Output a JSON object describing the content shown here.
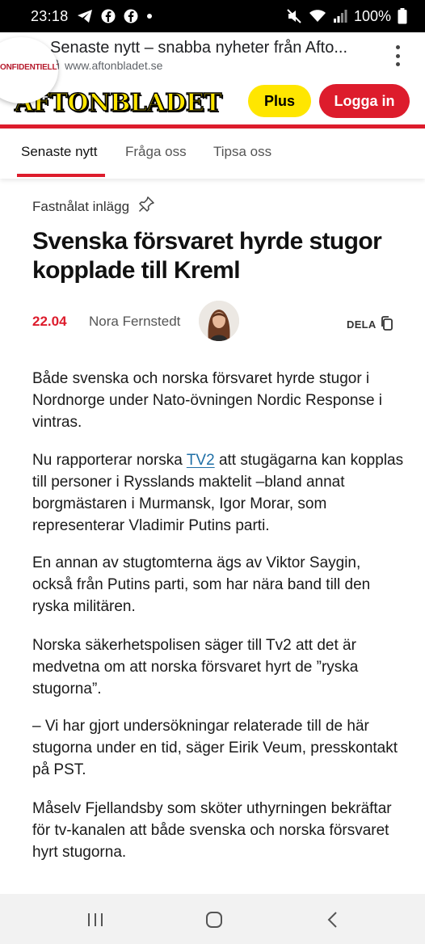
{
  "status_bar": {
    "time": "23:18",
    "battery": "100%",
    "icons": [
      "telegram-icon",
      "facebook-icon",
      "facebook-icon",
      "dot-icon",
      "mute-icon",
      "wifi-icon",
      "signal-icon",
      "battery-icon"
    ]
  },
  "browser": {
    "title": "Senaste nytt – snabba nyheter från Afto...",
    "url": "www.aftonbladet.se"
  },
  "site": {
    "logo_text": "AFTONBLADET",
    "plus_label": "Plus",
    "login_label": "Logga in",
    "brand_red": "#dd1c2c",
    "brand_yellow": "#ffe600"
  },
  "badge": {
    "text": "ONFIDENTIELLT"
  },
  "tabs": [
    {
      "label": "Senaste nytt",
      "active": true
    },
    {
      "label": "Fråga oss",
      "active": false
    },
    {
      "label": "Tipsa oss",
      "active": false
    }
  ],
  "article": {
    "pinned_label": "Fastnålat inlägg",
    "headline": "Svenska försvaret hyrde stugor kopplade till Kreml",
    "time": "22.04",
    "author": "Nora Fernstedt",
    "share_label": "DELA",
    "paragraphs": {
      "p1": "Både svenska och norska försvaret hyrde stugor i Nordnorge under Nato-övningen Nordic Response i vintras.",
      "p2_before": "Nu rapporterar norska ",
      "p2_link": "TV2",
      "p2_after": " att stugägarna kan kopplas till personer i Rysslands maktelit –bland annat borgmästaren i Murmansk, Igor Morar, som representerar Vladimir Putins parti.",
      "p3": "En annan av stugtomterna ägs av Viktor Saygin, också från Putins parti, som har nära band till den ryska militären.",
      "p4": "Norska säkerhetspolisen säger till Tv2 att det är medvetna om att norska försvaret hyrt de ”ryska stugorna”.",
      "p5": "– Vi har gjort undersökningar relaterade till de här stugorna under en tid, säger Eirik Veum, presskontakt på PST.",
      "p6": "Måselv Fjellandsby som sköter uthyrningen bekräftar för tv-kanalen att både svenska och norska försvaret hyrt stugorna."
    }
  },
  "nav": {
    "buttons": [
      "recent-apps-icon",
      "home-icon",
      "back-icon"
    ]
  }
}
